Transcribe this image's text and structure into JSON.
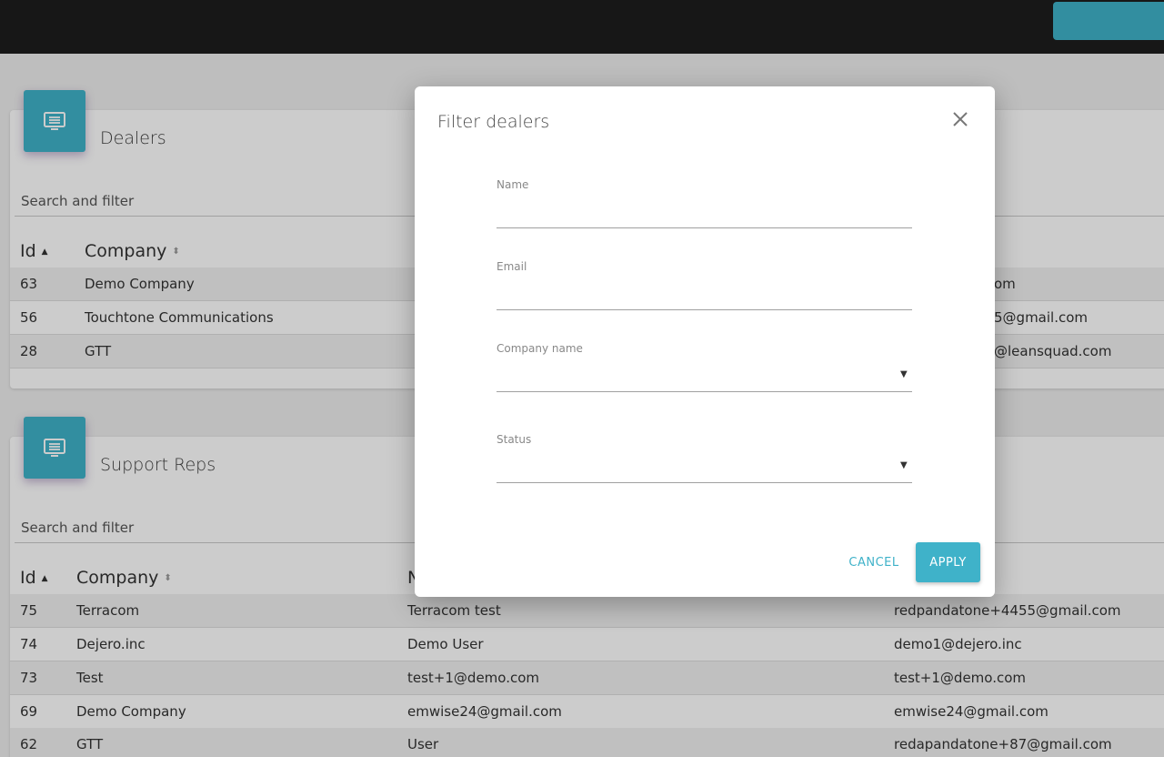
{
  "colors": {
    "accent": "#3fb2c9",
    "topbar": "#1d1d1d"
  },
  "dealers": {
    "title": "Dealers",
    "icon": "monitor-list-icon",
    "search_label": "Search and filter",
    "columns": {
      "id": "Id",
      "company": "Company"
    },
    "rows": [
      {
        "id": "63",
        "company": "Demo Company",
        "email": "om"
      },
      {
        "id": "56",
        "company": "Touchtone Communications",
        "email": "5@gmail.com"
      },
      {
        "id": "28",
        "company": "GTT",
        "email": "@leansquad.com"
      }
    ]
  },
  "support_reps": {
    "title": "Support Reps",
    "icon": "monitor-list-icon",
    "search_label": "Search and filter",
    "columns": {
      "id": "Id",
      "company": "Company",
      "name": "N"
    },
    "rows": [
      {
        "id": "75",
        "company": "Terracom",
        "name": "Terracom test",
        "email": "redpandatone+4455@gmail.com"
      },
      {
        "id": "74",
        "company": "Dejero.inc",
        "name": "Demo User",
        "email": "demo1@dejero.inc"
      },
      {
        "id": "73",
        "company": "Test",
        "name": "test+1@demo.com",
        "email": "test+1@demo.com"
      },
      {
        "id": "69",
        "company": "Demo Company",
        "name": "emwise24@gmail.com",
        "email": "emwise24@gmail.com"
      },
      {
        "id": "62",
        "company": "GTT",
        "name": "User",
        "email": "redapandatone+87@gmail.com"
      }
    ]
  },
  "modal": {
    "title": "Filter dealers",
    "fields": {
      "name": {
        "label": "Name",
        "value": ""
      },
      "email": {
        "label": "Email",
        "value": ""
      },
      "company_name": {
        "label": "Company name",
        "value": ""
      },
      "status": {
        "label": "Status",
        "value": ""
      }
    },
    "cancel_label": "CANCEL",
    "apply_label": "APPLY"
  }
}
